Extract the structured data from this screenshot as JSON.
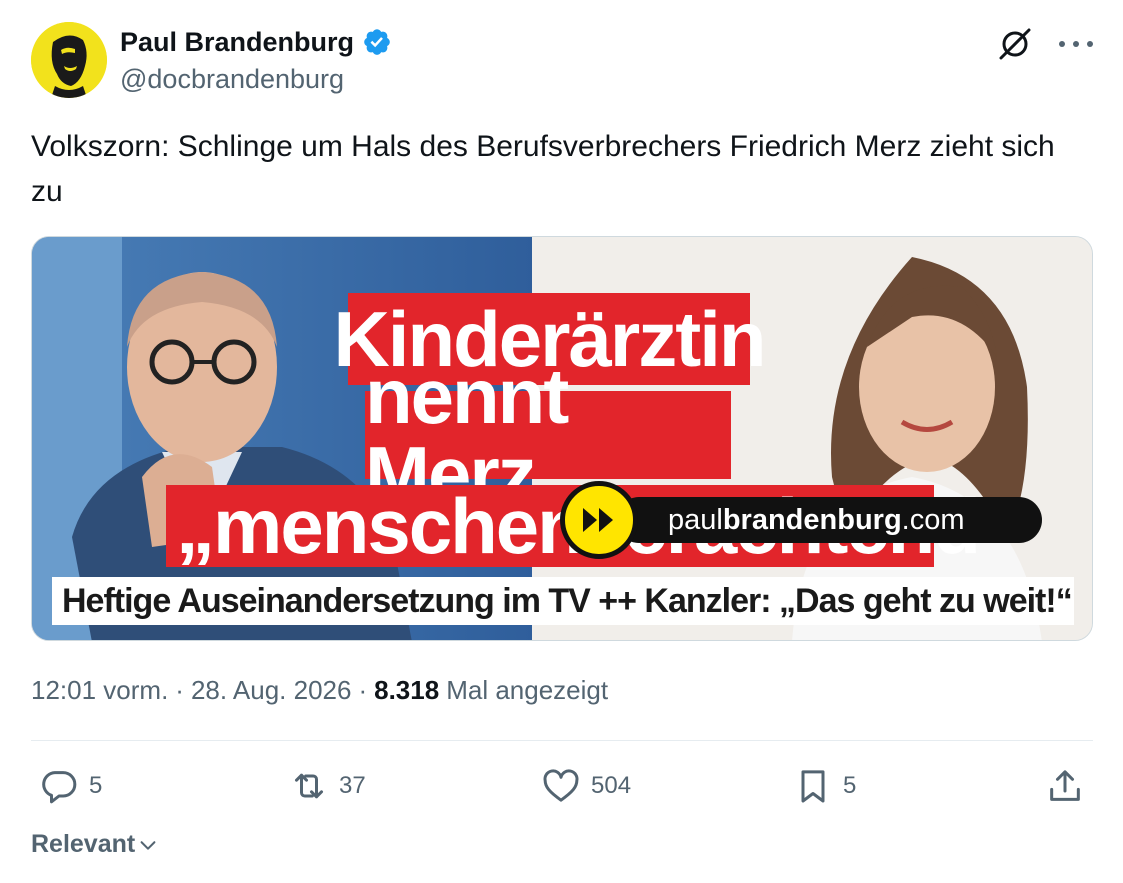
{
  "author": {
    "display_name": "Paul Brandenburg",
    "handle": "@docbrandenburg"
  },
  "tweet": {
    "text": "Volkszorn: Schlinge um Hals des Berufsverbrechers Friedrich Merz zieht sich zu"
  },
  "media": {
    "headline_line1": "Kinderärztin",
    "headline_line2": "nennt Merz",
    "headline_line3": "„menschenverachtend“",
    "subline": "Heftige Auseinandersetzung im TV ++ Kanzler: „Das geht zu weit!“",
    "watermark_prefix": "paul",
    "watermark_bold": "brandenburg",
    "watermark_suffix": ".com"
  },
  "meta": {
    "time": "12:01 vorm.",
    "separator": "·",
    "date": "28. Aug. 2026",
    "views_count": "8.318",
    "views_label": "Mal angezeigt"
  },
  "actions": {
    "replies": "5",
    "reposts": "37",
    "likes": "504",
    "bookmarks": "5"
  },
  "sort": {
    "label": "Relevant"
  },
  "icons": [
    "verified-badge-icon",
    "grok-icon",
    "more-icon",
    "reply-icon",
    "repost-icon",
    "like-icon",
    "bookmark-icon",
    "share-icon",
    "chevron-down-icon",
    "play-forward-icon"
  ],
  "colors": {
    "verified_blue": "#1d9bf0",
    "headline_red": "#e2252b",
    "brand_yellow": "#ffe500",
    "muted_text": "#536471"
  }
}
